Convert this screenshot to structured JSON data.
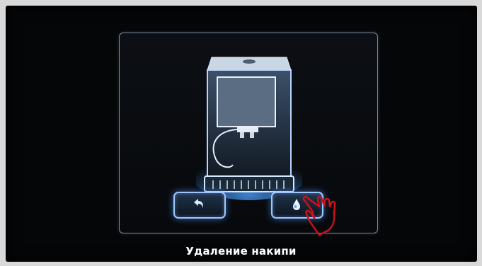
{
  "screen": {
    "caption": "Удаление накипи",
    "buttons": [
      {
        "icon": "back-arrow-icon"
      },
      {
        "icon": "drop-icon"
      }
    ],
    "illustration": "coffee-machine-icon",
    "pointer": "hand-pointer-icon",
    "accent_color": "#9ec7ff"
  }
}
